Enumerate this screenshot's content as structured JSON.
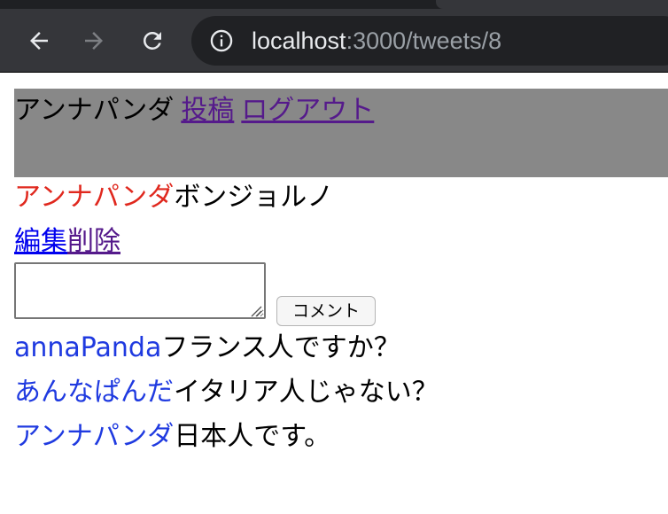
{
  "browser": {
    "url_host": "localhost",
    "url_path": ":3000/tweets/8"
  },
  "header": {
    "user_name": "アンナパンダ",
    "post_link": "投稿",
    "logout_link": "ログアウト"
  },
  "tweet": {
    "author": "アンナパンダ",
    "text": "ボンジョルノ",
    "edit_link": "編集",
    "delete_link": "削除"
  },
  "comment_form": {
    "value": "",
    "submit_label": "コメント"
  },
  "comments": [
    {
      "user": "annaPanda",
      "text": "フランス人ですか？"
    },
    {
      "user": "あんなぱんだ",
      "text": "イタリア人じゃない？"
    },
    {
      "user": "アンナパンダ",
      "text": "日本人です。"
    }
  ],
  "colors": {
    "header_bg": "#888888",
    "author_red": "#e0281e",
    "commenter_blue": "#1f3ae0",
    "link_visited": "#551a8b",
    "link": "#0000ee"
  }
}
